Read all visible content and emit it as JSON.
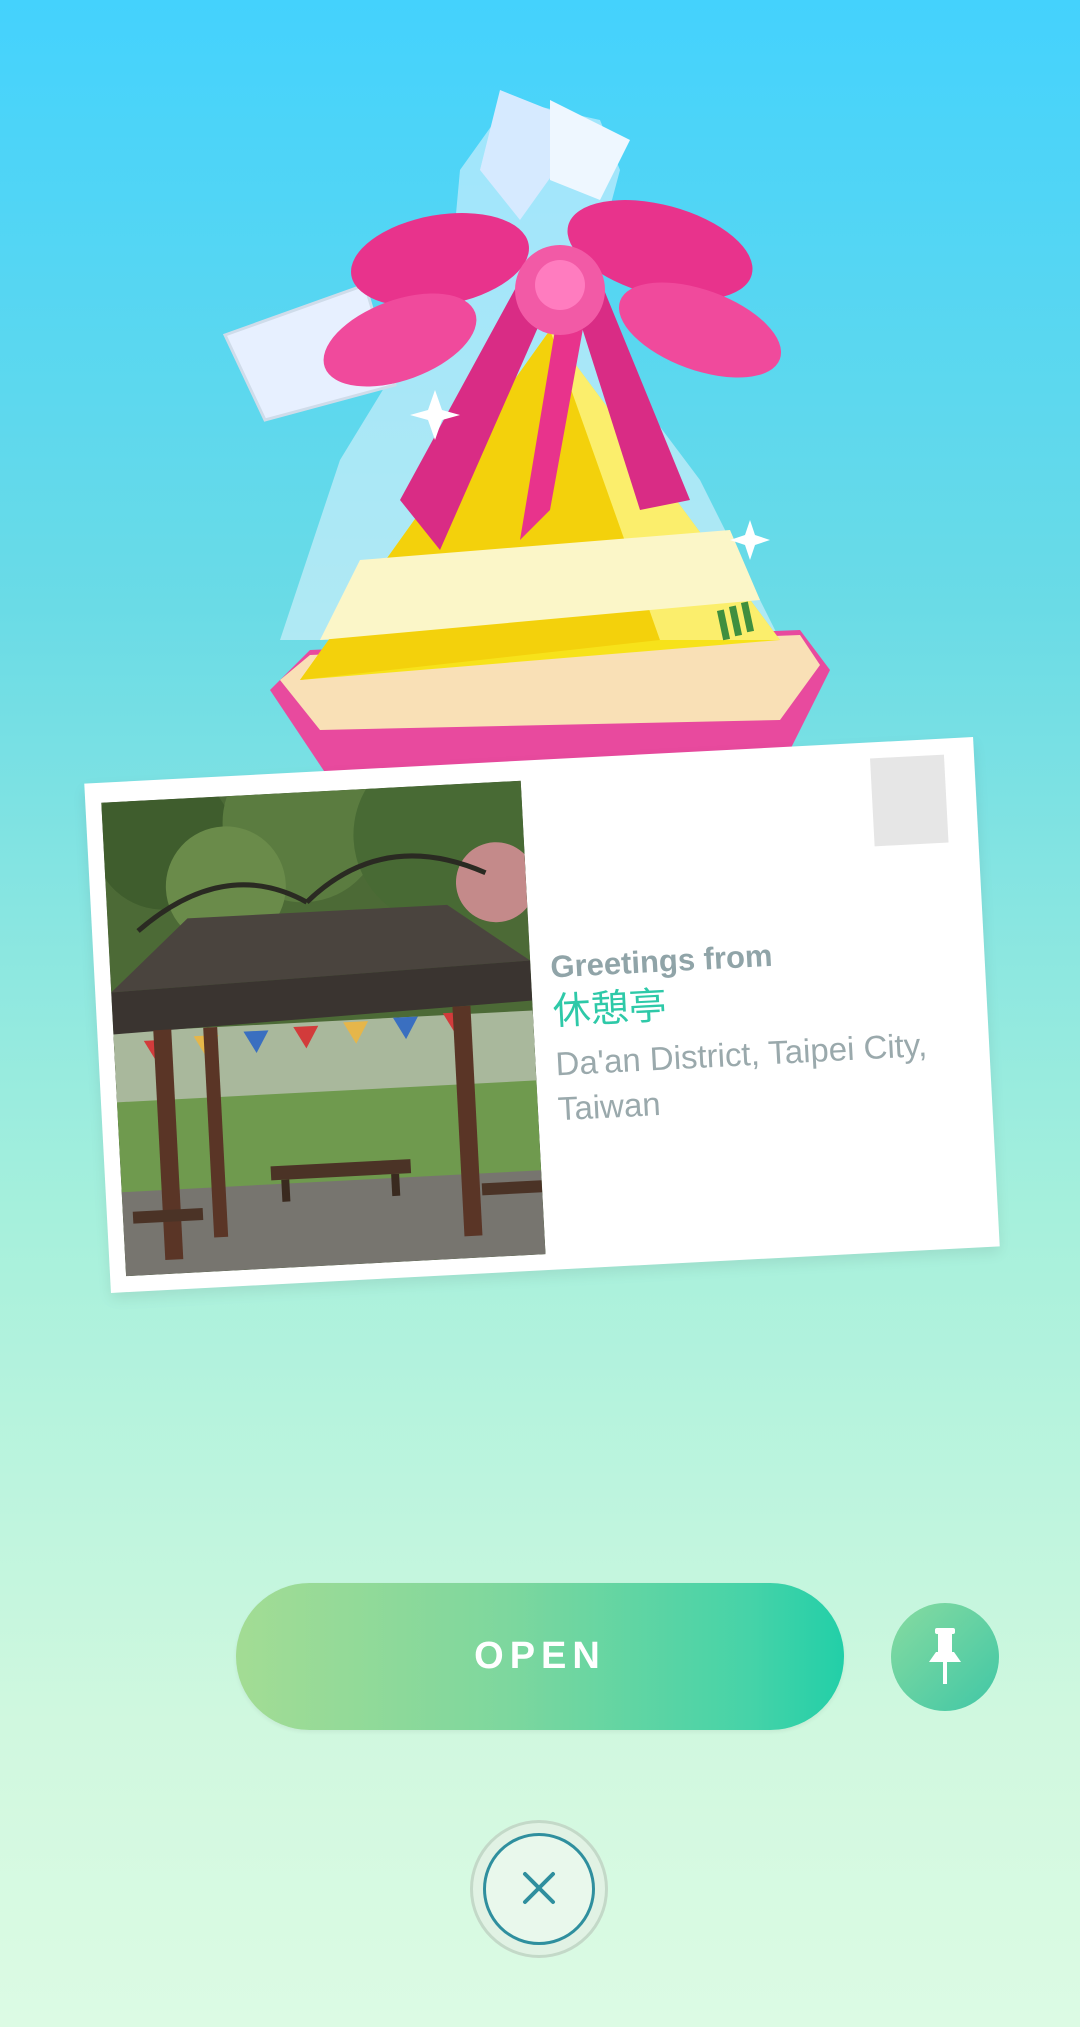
{
  "postcard": {
    "greeting": "Greetings from",
    "place_name": "休憩亭",
    "place_location": "Da'an District, Taipei City, Taiwan"
  },
  "actions": {
    "open_label": "OPEN",
    "pin_icon": "pin-icon",
    "close_icon": "close-icon"
  },
  "colors": {
    "accent": "#2ec9a8",
    "open_gradient_start": "#a3dc94",
    "open_gradient_end": "#22cfa8",
    "ribbon": "#e8338c",
    "gift_body": "#f7e21a"
  }
}
